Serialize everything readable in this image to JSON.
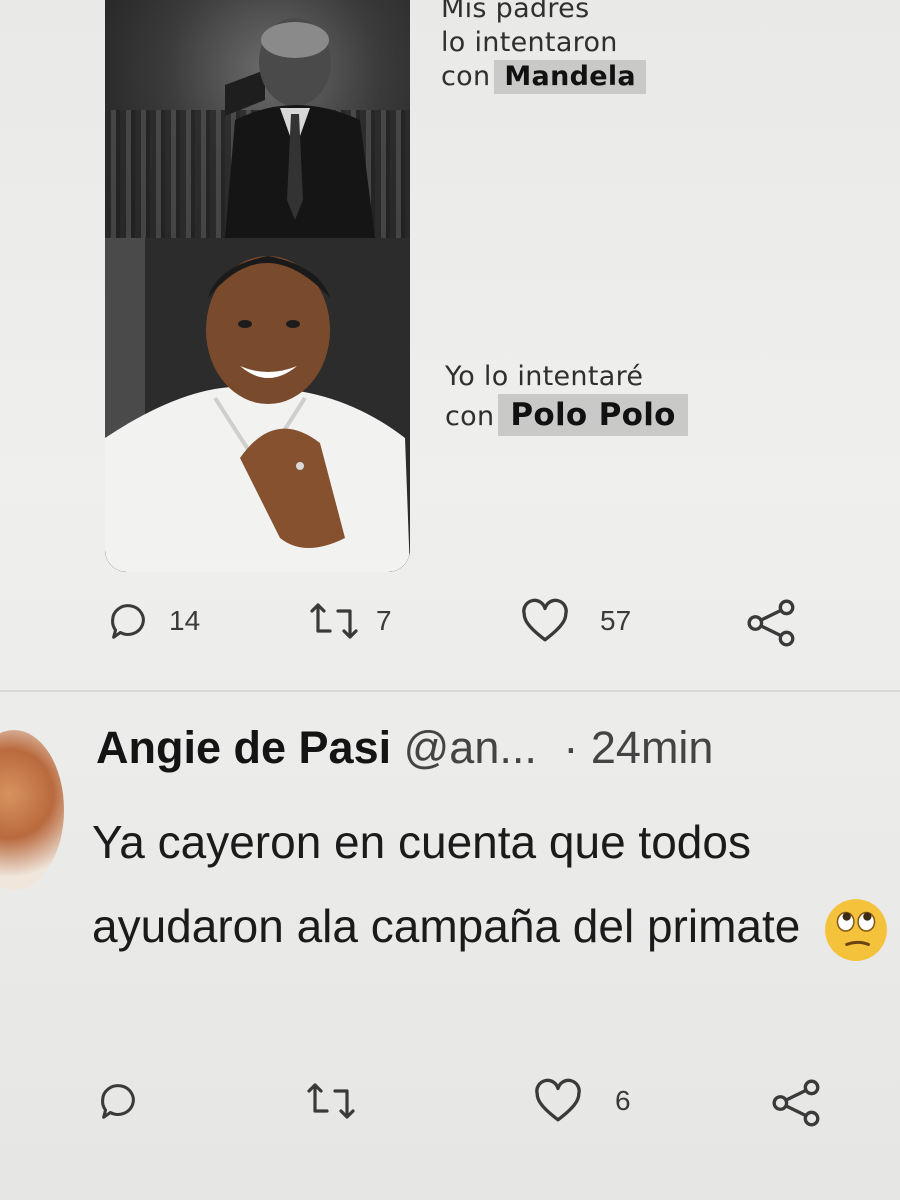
{
  "tweet1": {
    "meme": {
      "top_caption_line1": "Mis padres",
      "top_caption_line2": "lo intentaron",
      "top_caption_prefix": "con",
      "top_caption_name": "Mandela",
      "bottom_caption_line1": "Yo lo intentaré",
      "bottom_caption_prefix": "con",
      "bottom_caption_name": "Polo Polo"
    },
    "actions": {
      "replies": "14",
      "retweets": "7",
      "likes": "57"
    }
  },
  "tweet2": {
    "author_name": "Angie de Pasi",
    "handle": "@an...",
    "separator": "·",
    "time": "24min",
    "text": "Ya cayeron en cuenta que todos ayudaron ala campaña del primate",
    "emoji": "face-with-rolling-eyes",
    "actions": {
      "likes": "6"
    }
  },
  "colors": {
    "background": "#ececea",
    "text": "#1a1a1a",
    "icon": "#3a3a3a",
    "name_tag": "#c9c9c7",
    "emoji": "#f5c33b"
  },
  "icons": [
    "reply-icon",
    "retweet-icon",
    "like-icon",
    "share-icon"
  ]
}
